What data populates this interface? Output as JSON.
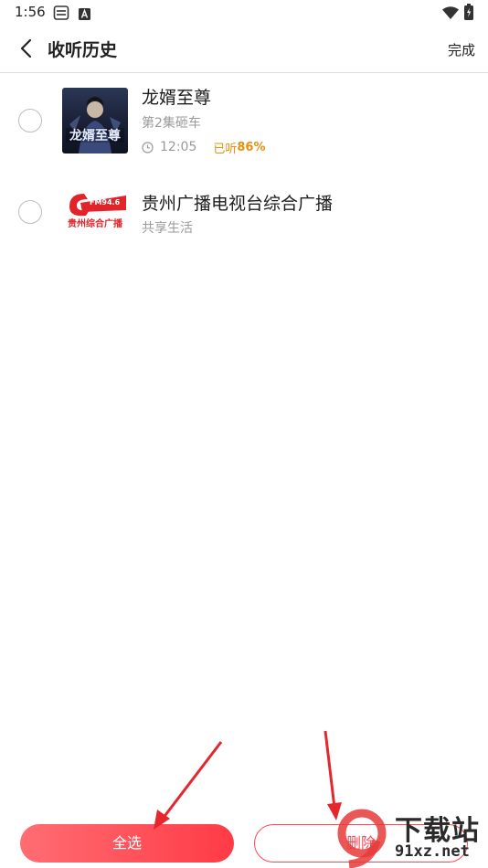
{
  "status_bar": {
    "time": "1:56",
    "icons": [
      "keyboard-icon",
      "a-badge-icon",
      "wifi-icon",
      "battery-icon"
    ]
  },
  "header": {
    "back_icon": "chevron-left-icon",
    "title": "收听历史",
    "done_label": "完成"
  },
  "history": [
    {
      "title": "龙婿至尊",
      "subtitle": "第2集砸车",
      "time": "12:05",
      "listened_prefix": "已听",
      "listened_percent": "86%",
      "cover_text": "龙婿至尊",
      "checked": false
    },
    {
      "title": "贵州广播电视台综合广播",
      "subtitle": "共享生活",
      "cover_text": "贵州综合广播",
      "cover_badge": "FM94.6",
      "checked": false
    }
  ],
  "bottom": {
    "select_all_label": "全选",
    "delete_label": "删除"
  },
  "watermark": {
    "main": "下载站",
    "sub": "91xz.net"
  },
  "colors": {
    "accent": "#ff4a54",
    "listened": "#e7900e",
    "arrow": "#e5262c"
  }
}
